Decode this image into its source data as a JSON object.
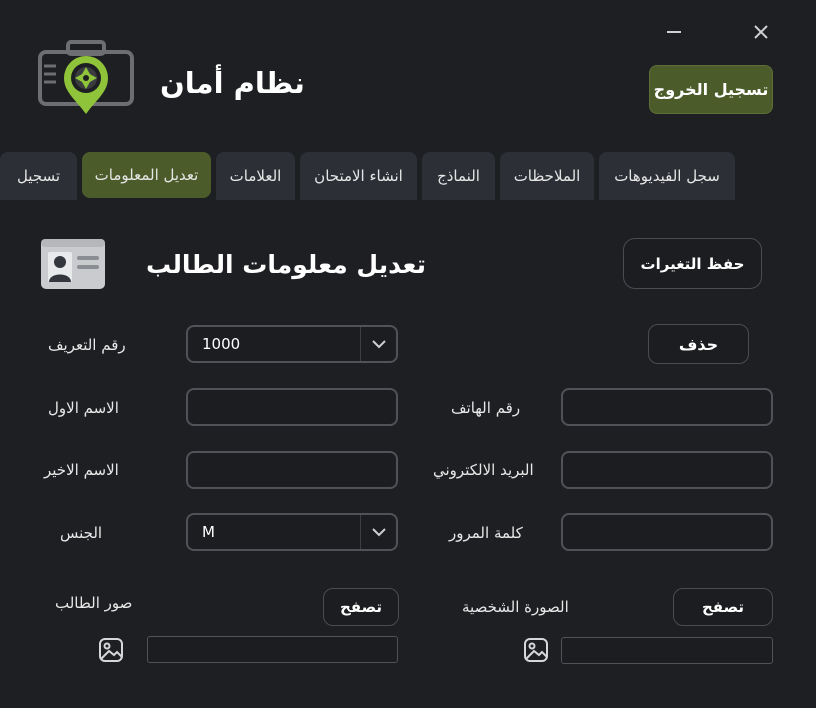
{
  "window": {
    "minimize_glyph": "—",
    "close_glyph": "✕"
  },
  "header": {
    "title": "نظام أمان",
    "logout_label": "تسجيل الخروج",
    "logo_icon": "camera-pin-icon"
  },
  "tabs": [
    {
      "label": "سجل الفيديوهات",
      "active": false
    },
    {
      "label": "الملاحظات",
      "active": false
    },
    {
      "label": "النماذج",
      "active": false
    },
    {
      "label": "انشاء الامتحان",
      "active": false
    },
    {
      "label": "العلامات",
      "active": false
    },
    {
      "label": "تعديل المعلومات",
      "active": true
    },
    {
      "label": "تسجيل",
      "active": false
    }
  ],
  "section": {
    "title": "تعديل معلومات الطالب",
    "icon": "id-card-icon",
    "save_label": "حفظ التغيرات",
    "delete_label": "حذف"
  },
  "form": {
    "id_label": "رقم التعريف",
    "id_value": "1000",
    "first_name_label": "الاسم الاول",
    "first_name_value": "",
    "last_name_label": "الاسم الاخير",
    "last_name_value": "",
    "gender_label": "الجنس",
    "gender_value": "M",
    "phone_label": "رقم الهاتف",
    "phone_value": "",
    "email_label": "البريد الالكتروني",
    "email_value": "",
    "password_label": "كلمة المرور",
    "password_value": "",
    "student_photos_label": "صور الطالب",
    "profile_photo_label": "الصورة الشخصية",
    "browse_label": "تصفح",
    "browse_label_2": "تصفح"
  },
  "colors": {
    "background": "#1e1f22",
    "accent": "#4b5c2a",
    "tab": "#2c2f36",
    "logo_green": "#8fc43a"
  }
}
